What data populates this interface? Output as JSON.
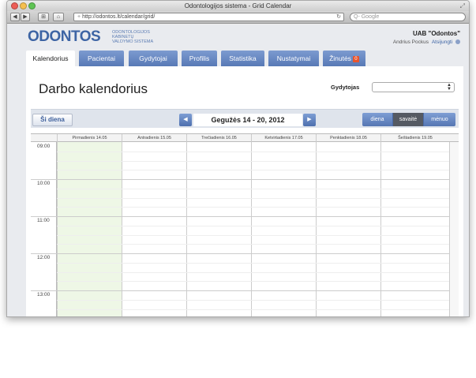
{
  "window": {
    "title": "Odontologijos sistema - Grid Calendar"
  },
  "browser": {
    "back": "◀",
    "forward": "▶",
    "grid": "⊞",
    "home": "⌂",
    "url": "http://odontos.lt/calendar/grid/",
    "search_placeholder": "Q- Google"
  },
  "brand": {
    "logo": "ODONTOS",
    "sub1": "ODONTOLOGIJOS",
    "sub2": "KABINETŲ",
    "sub3": "VALDYMO SISTEMA"
  },
  "account": {
    "company": "UAB \"Odontos\"",
    "user": "Andrius Pockus",
    "logout": "Atsijungti"
  },
  "tabs": [
    {
      "label": "Kalendorius"
    },
    {
      "label": "Pacientai"
    },
    {
      "label": "Gydytojai"
    },
    {
      "label": "Profilis"
    },
    {
      "label": "Statistika"
    },
    {
      "label": "Nustatymai"
    },
    {
      "label": "Žinutės",
      "badge": "0"
    }
  ],
  "page": {
    "title": "Darbo kalendorius",
    "doctor_label": "Gydytojas"
  },
  "calendar": {
    "today_label": "Ši diena",
    "range": "Gegužės 14 - 20, 2012",
    "prev": "◀",
    "next": "▶",
    "views": [
      "diena",
      "savaitė",
      "mėnuo"
    ],
    "active_view": "savaitė",
    "days": [
      "Pirmadienis 14.05",
      "Antradienis 15.05",
      "Trečiadienis 16.05",
      "Ketvirtadienis 17.05",
      "Penktadienis 18.05",
      "Šeštadienis 19.05"
    ],
    "times": [
      "09:00",
      "10:00",
      "11:00",
      "12:00",
      "13:00"
    ]
  }
}
